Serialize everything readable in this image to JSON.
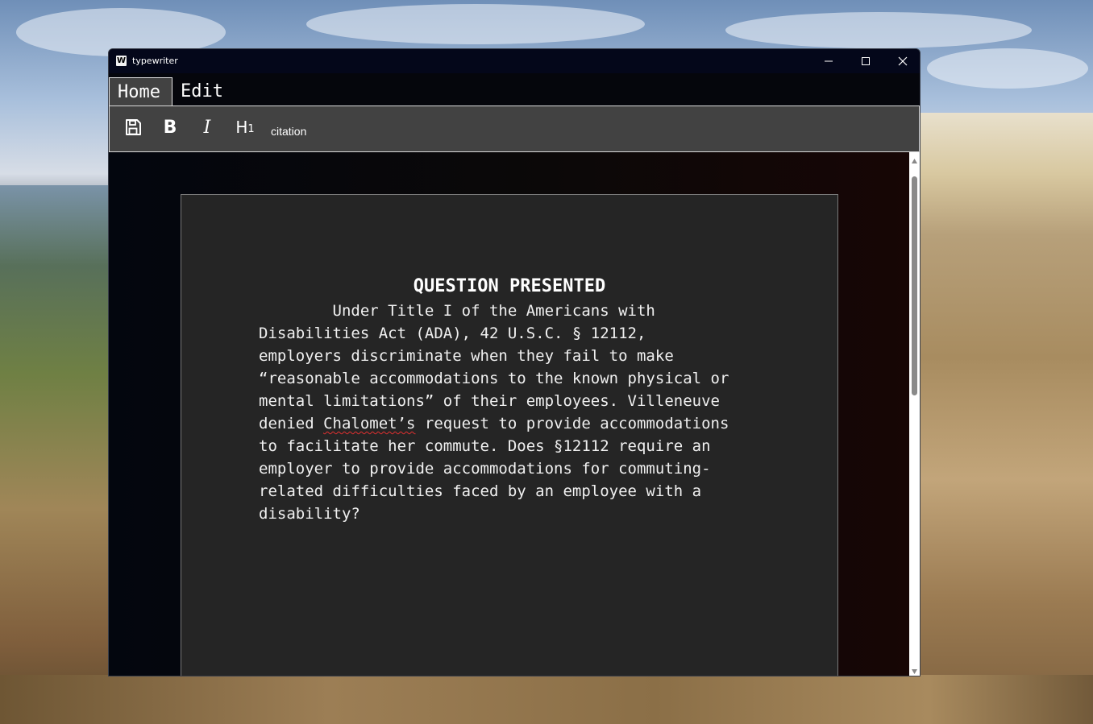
{
  "window": {
    "title": "typewriter",
    "app_icon": "W"
  },
  "tabs": [
    {
      "label": "Home",
      "selected": true
    },
    {
      "label": "Edit",
      "selected": false
    }
  ],
  "ribbon": {
    "save_icon": "save-icon",
    "bold_label": "B",
    "italic_label": "I",
    "heading_label": "H",
    "heading_level": "1",
    "citation_label": "citation"
  },
  "document": {
    "heading": "QUESTION PRESENTED",
    "body_lines": [
      "        Under Title I of the Americans with",
      "Disabilities Act (ADA), 42 U.S.C. § 12112,",
      "employers discriminate when they fail to make",
      "“reasonable accommodations to the known physical or",
      "mental limitations” of their employees. Villeneuve",
      "denied ",
      "to facilitate her commute. Does §12112 require an",
      "employer to provide accommodations for commuting-",
      "related difficulties faced by an employee with a",
      "disability?"
    ],
    "misspelled_word": "Chalomet’s",
    "line6_rest": " request to provide accommodations"
  },
  "colors": {
    "titlebar": "#04071a",
    "ribbon": "#424242",
    "page": "#252525",
    "spellcheck": "#e23030"
  }
}
